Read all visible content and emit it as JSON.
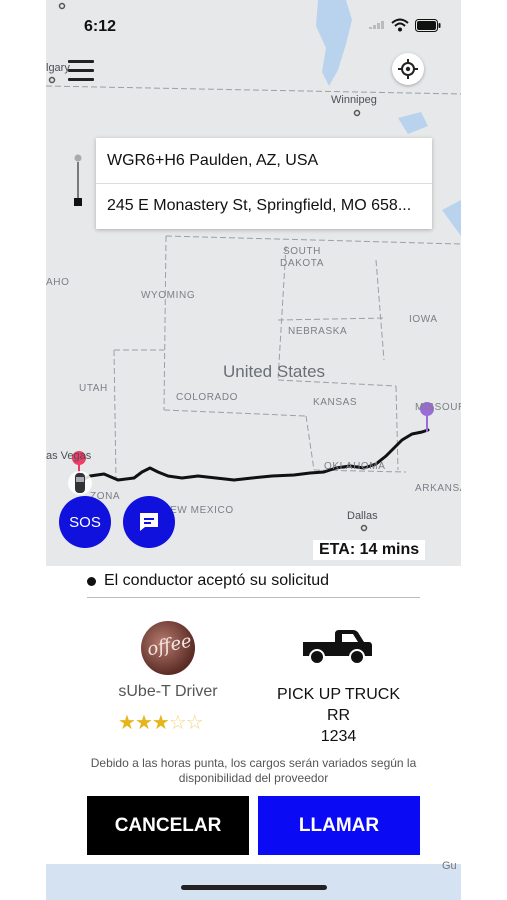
{
  "status_bar": {
    "time": "6:12"
  },
  "map": {
    "labels": {
      "calgary": "lgary",
      "winnipeg": "Winnipeg",
      "south_dakota": "SOUTH\nDAKOTA",
      "idaho": "AHO",
      "wyoming": "WYOMING",
      "nebraska": "NEBRASKA",
      "iowa": "IOWA",
      "united_states": "United States",
      "utah": "UTAH",
      "colorado": "COLORADO",
      "kansas": "KANSAS",
      "missouri": "MISSOUR",
      "las_vegas": "as Vegas",
      "arizona": "ZONA",
      "new_mexico": "EW MEXICO",
      "oklahoma": "OKLAHOMA",
      "arkansas": "ARKANSA",
      "dallas": "Dallas",
      "bottom_fragment": "Gu"
    },
    "origin_pin_color": "#ef3b66",
    "destination_pin_color": "#9b6bd6"
  },
  "route": {
    "origin": "WGR6+H6 Paulden, AZ, USA",
    "destination": "245 E Monastery St, Springfield, MO 658..."
  },
  "buttons": {
    "sos": "SOS",
    "cancel": "CANCELAR",
    "call": "LLAMAR"
  },
  "eta": "ETA: 14 mins",
  "trip_status": "El conductor aceptó su solicitud",
  "driver": {
    "name": "sUbe-T Driver",
    "avatar_text": "offee",
    "rating": 3,
    "rating_max": 5
  },
  "vehicle": {
    "type": "PICK UP TRUCK",
    "model": "RR",
    "plate": "1234"
  },
  "note": "Debido a las horas punta, los cargos serán variados según la disponibilidad del proveedor",
  "colors": {
    "primary_blue": "#1111dd",
    "call_button": "#0a0af5",
    "cancel_button": "#000000",
    "star": "#e6b51e"
  }
}
